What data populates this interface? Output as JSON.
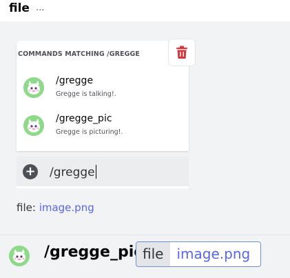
{
  "header": {
    "title": "file",
    "ellipsis": "..."
  },
  "popup": {
    "title": "COMMANDS MATCHING /GREGGE",
    "commands": [
      {
        "name": "/gregge",
        "description": "Gregge is talking!."
      },
      {
        "name": "/gregge_pic",
        "description": "Gregge is picturing!."
      }
    ]
  },
  "input": {
    "value": "/gregge"
  },
  "file_line": {
    "label": "file:",
    "value": "image.png"
  },
  "bottom": {
    "command": "/gregge_pic",
    "option_name": "file",
    "option_value": "image.png"
  },
  "colors": {
    "trash": "#da373c",
    "link": "#5865f2",
    "avatar_bg": "#8fd98a"
  },
  "icons": [
    "trash-icon",
    "plus-icon",
    "avatar-icon"
  ]
}
